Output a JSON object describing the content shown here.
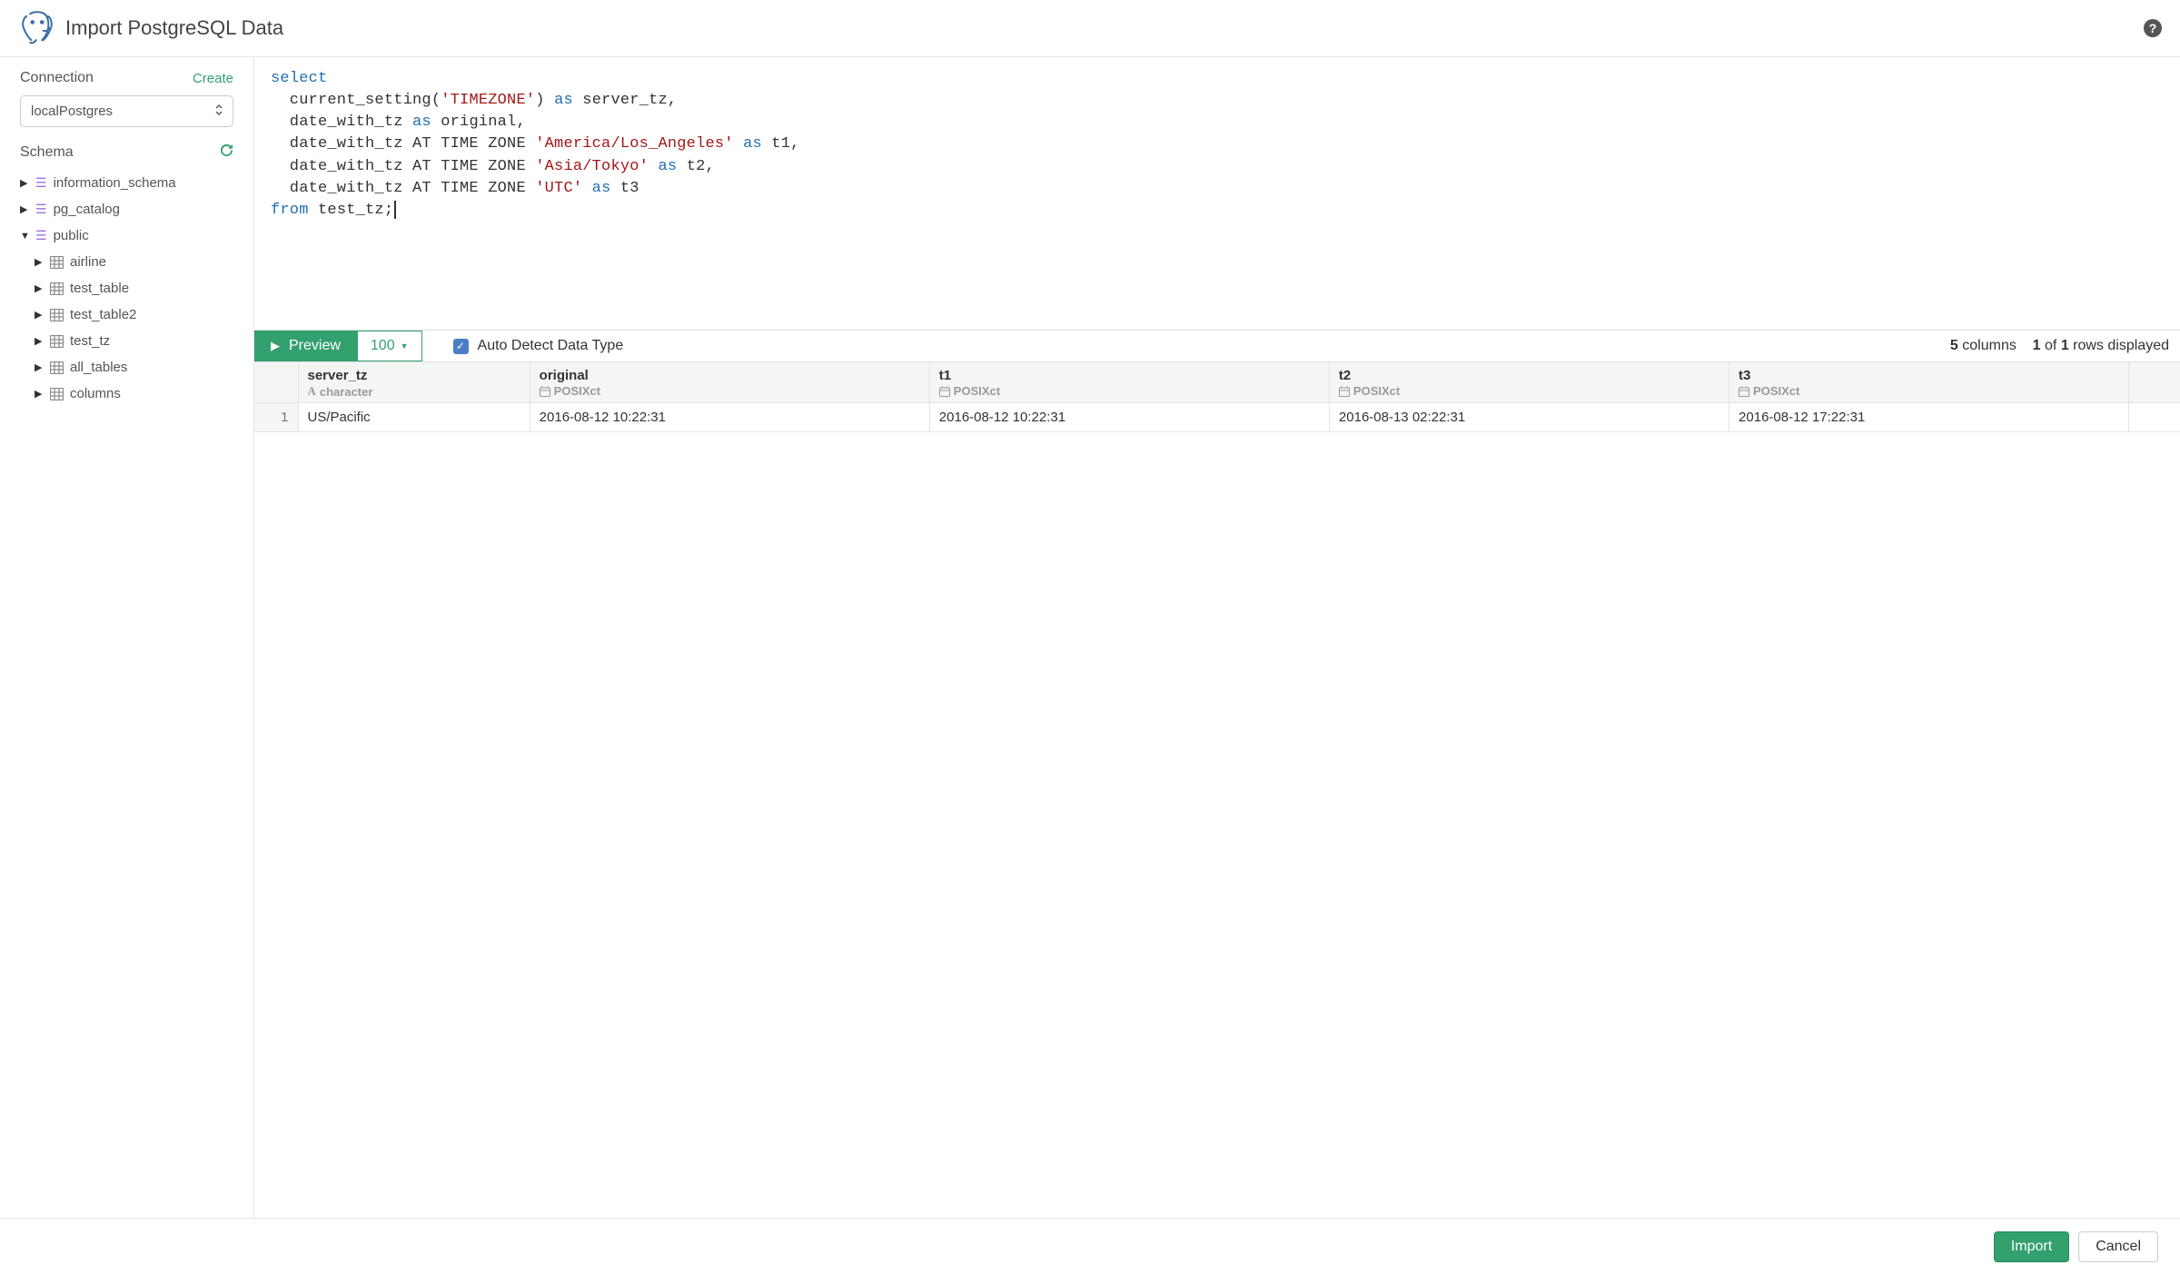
{
  "header": {
    "title": "Import PostgreSQL Data"
  },
  "sidebar": {
    "connection_label": "Connection",
    "create_label": "Create",
    "connection_value": "localPostgres",
    "schema_label": "Schema",
    "tree": [
      {
        "name": "information_schema",
        "type": "schema",
        "expanded": false
      },
      {
        "name": "pg_catalog",
        "type": "schema",
        "expanded": false
      },
      {
        "name": "public",
        "type": "schema",
        "expanded": true,
        "children": [
          {
            "name": "airline",
            "type": "table"
          },
          {
            "name": "test_table",
            "type": "table"
          },
          {
            "name": "test_table2",
            "type": "table"
          },
          {
            "name": "test_tz",
            "type": "table"
          },
          {
            "name": "all_tables",
            "type": "table"
          },
          {
            "name": "columns",
            "type": "table"
          }
        ]
      }
    ]
  },
  "editor": {
    "lines": [
      [
        {
          "t": "select",
          "c": "kw"
        }
      ],
      [
        {
          "t": "  current_setting(",
          "c": ""
        },
        {
          "t": "'TIMEZONE'",
          "c": "str"
        },
        {
          "t": ") ",
          "c": ""
        },
        {
          "t": "as",
          "c": "kw"
        },
        {
          "t": " server_tz,",
          "c": ""
        }
      ],
      [
        {
          "t": "  date_with_tz ",
          "c": ""
        },
        {
          "t": "as",
          "c": "kw"
        },
        {
          "t": " original,",
          "c": ""
        }
      ],
      [
        {
          "t": "  date_with_tz ",
          "c": ""
        },
        {
          "t": "AT",
          "c": ""
        },
        {
          "t": " TIME ZONE ",
          "c": ""
        },
        {
          "t": "'America/Los_Angeles'",
          "c": "str"
        },
        {
          "t": " ",
          "c": ""
        },
        {
          "t": "as",
          "c": "kw"
        },
        {
          "t": " t1,",
          "c": ""
        }
      ],
      [
        {
          "t": "  date_with_tz ",
          "c": ""
        },
        {
          "t": "AT",
          "c": ""
        },
        {
          "t": " TIME ZONE ",
          "c": ""
        },
        {
          "t": "'Asia/Tokyo'",
          "c": "str"
        },
        {
          "t": " ",
          "c": ""
        },
        {
          "t": "as",
          "c": "kw"
        },
        {
          "t": " t2,",
          "c": ""
        }
      ],
      [
        {
          "t": "  date_with_tz ",
          "c": ""
        },
        {
          "t": "AT",
          "c": ""
        },
        {
          "t": " TIME ZONE ",
          "c": ""
        },
        {
          "t": "'UTC'",
          "c": "str"
        },
        {
          "t": " ",
          "c": ""
        },
        {
          "t": "as",
          "c": "kw"
        },
        {
          "t": " t3",
          "c": ""
        }
      ],
      [
        {
          "t": "from",
          "c": "kw"
        },
        {
          "t": " test_tz;",
          "c": ""
        }
      ]
    ]
  },
  "toolbar": {
    "preview_label": "Preview",
    "limit_value": "100",
    "auto_detect_label": "Auto Detect Data Type",
    "auto_detect_checked": true,
    "columns_count": "5",
    "columns_word": "columns",
    "rows_shown": "1",
    "rows_of_word": "of",
    "rows_total": "1",
    "rows_word": "rows displayed"
  },
  "grid": {
    "columns": [
      {
        "name": "server_tz",
        "type": "character",
        "icon": "A"
      },
      {
        "name": "original",
        "type": "POSIXct",
        "icon": "cal"
      },
      {
        "name": "t1",
        "type": "POSIXct",
        "icon": "cal"
      },
      {
        "name": "t2",
        "type": "POSIXct",
        "icon": "cal"
      },
      {
        "name": "t3",
        "type": "POSIXct",
        "icon": "cal"
      }
    ],
    "rows": [
      {
        "n": "1",
        "cells": [
          "US/Pacific",
          "2016-08-12 10:22:31",
          "2016-08-12 10:22:31",
          "2016-08-13 02:22:31",
          "2016-08-12 17:22:31"
        ]
      }
    ]
  },
  "footer": {
    "import_label": "Import",
    "cancel_label": "Cancel"
  }
}
